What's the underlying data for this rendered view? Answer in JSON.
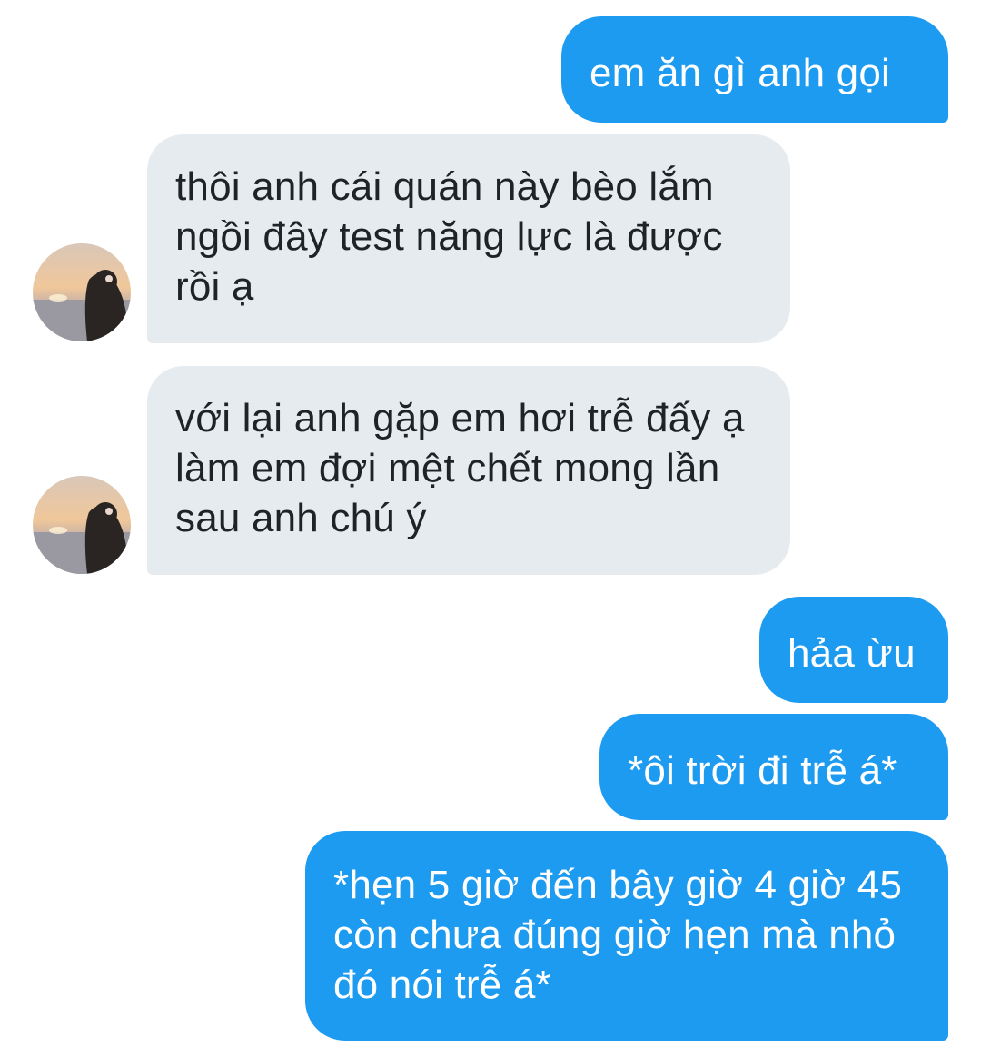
{
  "messages": [
    {
      "direction": "outgoing",
      "text": "em ăn gì anh gọi"
    },
    {
      "direction": "incoming",
      "text": "thôi anh cái quán này bèo lắm ngồi đây test năng lực là được rồi ạ"
    },
    {
      "direction": "incoming",
      "text": "với lại anh gặp em hơi trễ đấy ạ làm em đợi mệt chết mong lần sau anh chú ý"
    },
    {
      "direction": "outgoing",
      "text": "hảa ừu"
    },
    {
      "direction": "outgoing",
      "text": "*ôi trời đi trễ á*"
    },
    {
      "direction": "outgoing",
      "text": "*hẹn 5 giờ đến bây giờ 4 giờ 45 còn chưa đúng giờ hẹn mà nhỏ đó nói trễ á*"
    }
  ],
  "avatar_icon": "contact-avatar-photo-icon",
  "colors": {
    "outgoing_bubble": "#1d9bf0",
    "incoming_bubble": "#e6ebef",
    "incoming_text": "#1f2326",
    "background": "#ffffff"
  }
}
